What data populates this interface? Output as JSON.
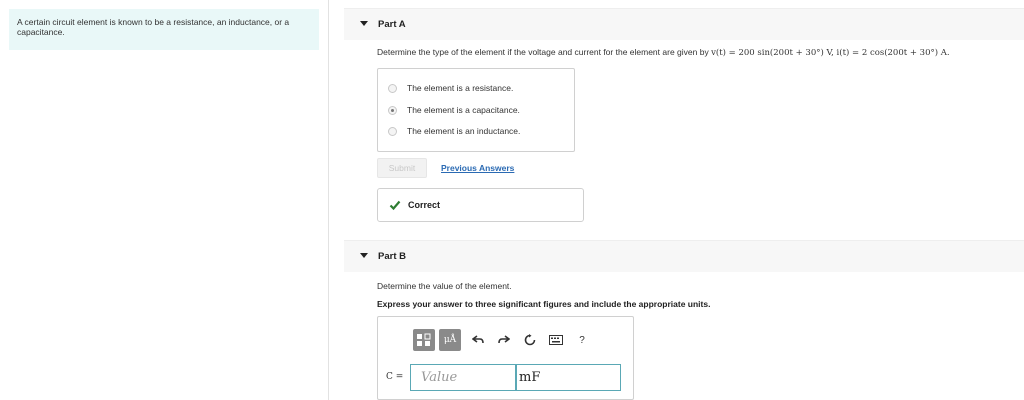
{
  "problem": {
    "text": "A certain circuit element is known to be a resistance, an inductance, or a capacitance."
  },
  "part_a": {
    "title": "Part A",
    "question": "Determine the type of the element if the voltage and current for the element are given by",
    "formula": "v(t) = 200 sin(200t + 30°) V, i(t) = 2 cos(200t + 30°) A.",
    "choices": [
      {
        "label": "The element is a resistance.",
        "selected": false
      },
      {
        "label": "The element is a capacitance.",
        "selected": true
      },
      {
        "label": "The element is an inductance.",
        "selected": false
      }
    ],
    "submit_label": "Submit",
    "previous_answers_label": "Previous Answers",
    "result_label": "Correct"
  },
  "part_b": {
    "title": "Part B",
    "question": "Determine the value of the element.",
    "instruction": "Express your answer to three significant figures and include the appropriate units.",
    "toolbar": {
      "units_button_label": "μÅ",
      "help_label": "?"
    },
    "variable_label": "C =",
    "value_placeholder": "Value",
    "unit_value": "mF"
  },
  "colors": {
    "problem_bg": "#e9f8f8",
    "link": "#2a6ab3",
    "check": "#2e7d32",
    "input_border": "#5aa8b5"
  }
}
